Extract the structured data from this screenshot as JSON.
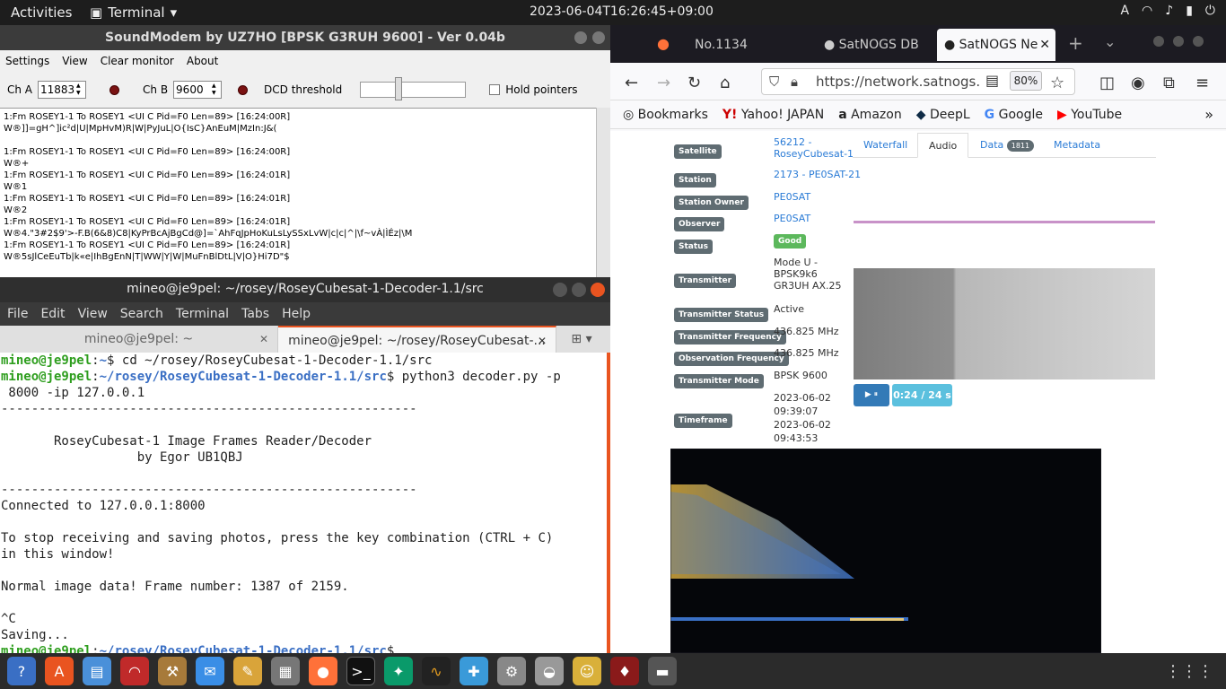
{
  "topbar": {
    "activities": "Activities",
    "app": "Terminal",
    "clock": "2023-06-04T16:26:45+09:00",
    "input": "A"
  },
  "soundmodem": {
    "title": "SoundModem by UZ7HO [BPSK G3RUH 9600] - Ver 0.04b",
    "menu": [
      "Settings",
      "View",
      "Clear monitor",
      "About"
    ],
    "cha_label": "Ch A",
    "cha_value": "11883",
    "chb_label": "Ch B",
    "chb_value": "9600",
    "dcd_label": "DCD threshold",
    "hold_label": "Hold pointers",
    "monitor_lines": [
      "1:Fm ROSEY1-1 To ROSEY1 <UI C Pid=F0 Len=89> [16:24:00R]",
      "W®]]=gH^]ic²d|U|MpHvM)R|W|PyJuL|O{IsC}AnEuM|MzIn:J&(",
      "",
      "1:Fm ROSEY1-1 To ROSEY1 <UI C Pid=F0 Len=89> [16:24:00R]",
      "W®+",
      "1:Fm ROSEY1-1 To ROSEY1 <UI C Pid=F0 Len=89> [16:24:01R]",
      "W®1",
      "1:Fm ROSEY1-1 To ROSEY1 <UI C Pid=F0 Len=89> [16:24:01R]",
      "W®2",
      "1:Fm ROSEY1-1 To ROSEY1 <UI C Pid=F0 Len=89> [16:24:01R]",
      "W®4.\"3#2$9'>-F.B(6&8)C8|KyPrBcAjBgCd@]=`AhFqJpHoKuLsLySSxLvW|c|c|^|\\f~vÀ|ÌÉz|\\M",
      "1:Fm ROSEY1-1 To ROSEY1 <UI C Pid=F0 Len=89> [16:24:01R]",
      "W®5sJlCeEuTb|k«e|IhBgEnN|T|WW|Y|W|MuFnBlDtL|V|O}Hi7D\"$"
    ]
  },
  "terminal": {
    "title": "mineo@je9pel: ~/rosey/RoseyCubesat-1-Decoder-1.1/src",
    "menu": [
      "File",
      "Edit",
      "View",
      "Search",
      "Terminal",
      "Tabs",
      "Help"
    ],
    "tab1": "mineo@je9pel: ~",
    "tab2": "mineo@je9pel: ~/rosey/RoseyCubesat-...",
    "prompt_user": "mineo@je9pel",
    "cmd1_path": "~",
    "cmd1": "$ cd ~/rosey/RoseyCubesat-1-Decoder-1.1/src",
    "cmd2_path": "~/rosey/RoseyCubesat-1-Decoder-1.1/src",
    "cmd2": "$ python3 decoder.py -p",
    "cmd2_cont": " 8000 -ip 127.0.0.1",
    "rule": "-------------------------------------------------------",
    "banner1": "       RoseyCubesat-1 Image Frames Reader/Decoder",
    "banner2": "                  by Egor UB1QBJ",
    "connected": "Connected to 127.0.0.1:8000",
    "stop1": "To stop receiving and saving photos, press the key combination (CTRL + C)",
    "stop2": "in this window!",
    "normal": "Normal image data! Frame number: 1387 of 2159.",
    "ctrlc": "^C",
    "saving": "Saving...",
    "final_path": "~/rosey/RoseyCubesat-1-Decoder-1.1/src",
    "final_prompt": "$"
  },
  "firefox": {
    "tabs": [
      "No.1134",
      "SatNOGS DB",
      "SatNOGS Ne"
    ],
    "url": "https://network.satnogs.",
    "zoom": "80%",
    "bookmarks": [
      "Bookmarks",
      "Yahoo! JAPAN",
      "Amazon",
      "DeepL",
      "Google",
      "YouTube"
    ],
    "fields": [
      {
        "label": "Satellite",
        "value": "56212 - RoseyCubesat-1"
      },
      {
        "label": "Station",
        "value": "2173 - PE0SAT-21"
      },
      {
        "label": "Station Owner",
        "value": "PE0SAT"
      },
      {
        "label": "Observer",
        "value": "PE0SAT"
      },
      {
        "label": "Status",
        "value": "Good"
      },
      {
        "label": "Transmitter",
        "value": "Mode U - BPSK9k6 GR3UH AX.25"
      },
      {
        "label": "Transmitter Status",
        "value": "Active"
      },
      {
        "label": "Transmitter Frequency",
        "value": "436.825 MHz"
      },
      {
        "label": "Observation Frequency",
        "value": "436.825 MHz"
      },
      {
        "label": "Transmitter Mode",
        "value": "BPSK 9600"
      },
      {
        "label": "Timeframe",
        "value": "2023-06-02 09:39:07 2023-06-02 09:43:53"
      }
    ],
    "detail_tabs": [
      "Waterfall",
      "Audio",
      "Data",
      "Metadata"
    ],
    "data_count": "1811",
    "player_time": "0:24 / 24 s"
  }
}
